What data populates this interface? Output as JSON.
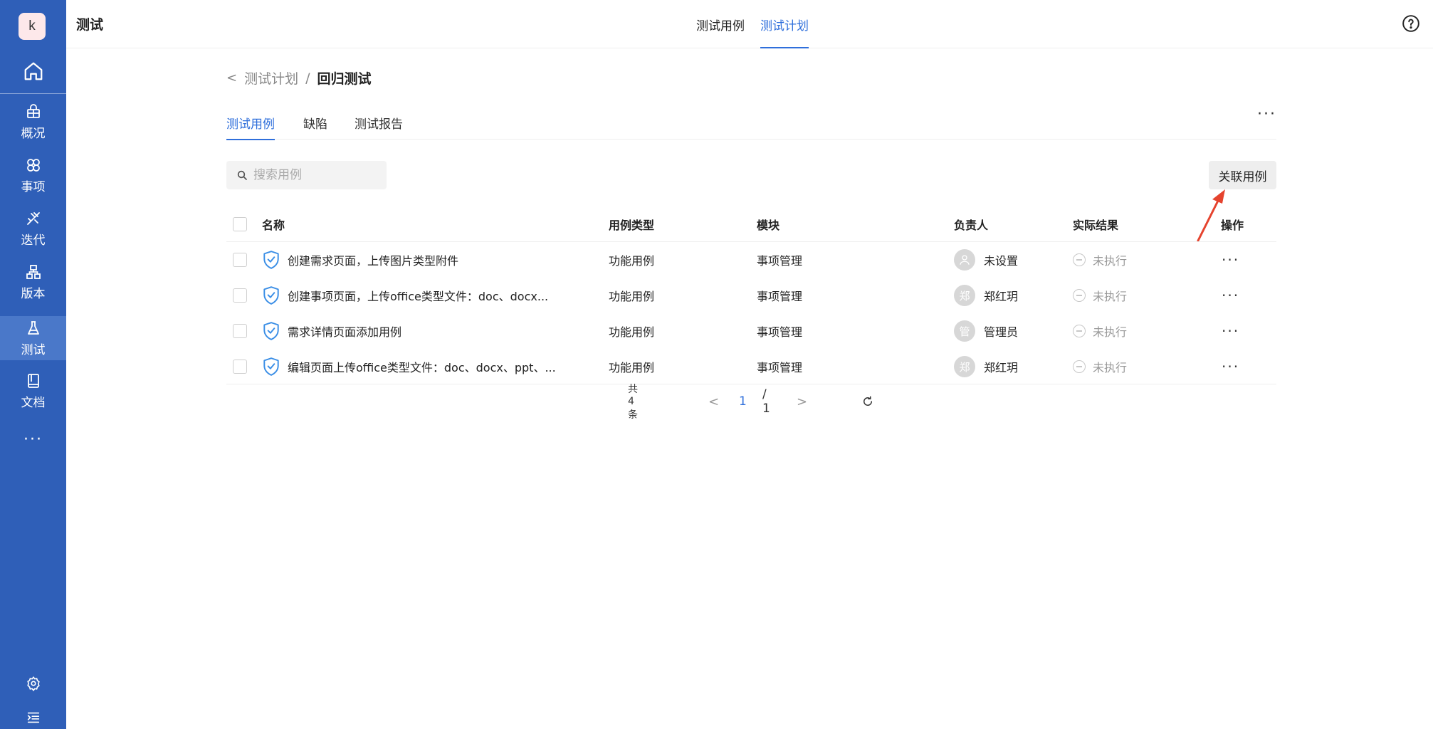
{
  "sidebar": {
    "avatar": "k",
    "items": [
      {
        "label": "概况",
        "icon": "overview-icon"
      },
      {
        "label": "事项",
        "icon": "issues-icon"
      },
      {
        "label": "迭代",
        "icon": "sprint-icon"
      },
      {
        "label": "版本",
        "icon": "version-icon"
      },
      {
        "label": "测试",
        "icon": "test-icon"
      },
      {
        "label": "文档",
        "icon": "docs-icon"
      }
    ],
    "more": "···"
  },
  "header": {
    "title": "测试",
    "tabs": [
      {
        "label": "测试用例"
      },
      {
        "label": "测试计划"
      }
    ]
  },
  "breadcrumb": {
    "back": "<",
    "parent": "测试计划",
    "separator": "/",
    "current": "回归测试"
  },
  "subtabs": [
    {
      "label": "测试用例"
    },
    {
      "label": "缺陷"
    },
    {
      "label": "测试报告"
    }
  ],
  "subtabs_more": "···",
  "search": {
    "placeholder": "搜索用例"
  },
  "toolbar": {
    "associate_label": "关联用例"
  },
  "table": {
    "columns": {
      "name": "名称",
      "type": "用例类型",
      "module": "模块",
      "owner": "负责人",
      "result": "实际结果",
      "ops": "操作"
    },
    "rows": [
      {
        "name": "创建需求页面，上传图片类型附件",
        "type": "功能用例",
        "module": "事项管理",
        "owner": "未设置",
        "avatar": "",
        "result": "未执行",
        "ops": "···"
      },
      {
        "name": "创建事项页面，上传office类型文件：doc、docx...",
        "type": "功能用例",
        "module": "事项管理",
        "owner": "郑红玥",
        "avatar": "郑",
        "result": "未执行",
        "ops": "···"
      },
      {
        "name": "需求详情页面添加用例",
        "type": "功能用例",
        "module": "事项管理",
        "owner": "管理员",
        "avatar": "管",
        "result": "未执行",
        "ops": "···"
      },
      {
        "name": "编辑页面上传office类型文件：doc、docx、ppt、...",
        "type": "功能用例",
        "module": "事项管理",
        "owner": "郑红玥",
        "avatar": "郑",
        "result": "未执行",
        "ops": "···"
      }
    ]
  },
  "pagination": {
    "total": "共4条",
    "prev": "<",
    "current": "1",
    "total_pages": "/ 1",
    "next": ">"
  },
  "colors": {
    "sidebar_bg": "#2f5fb8",
    "accent": "#2f6fdb",
    "arrow": "#e5432e"
  }
}
